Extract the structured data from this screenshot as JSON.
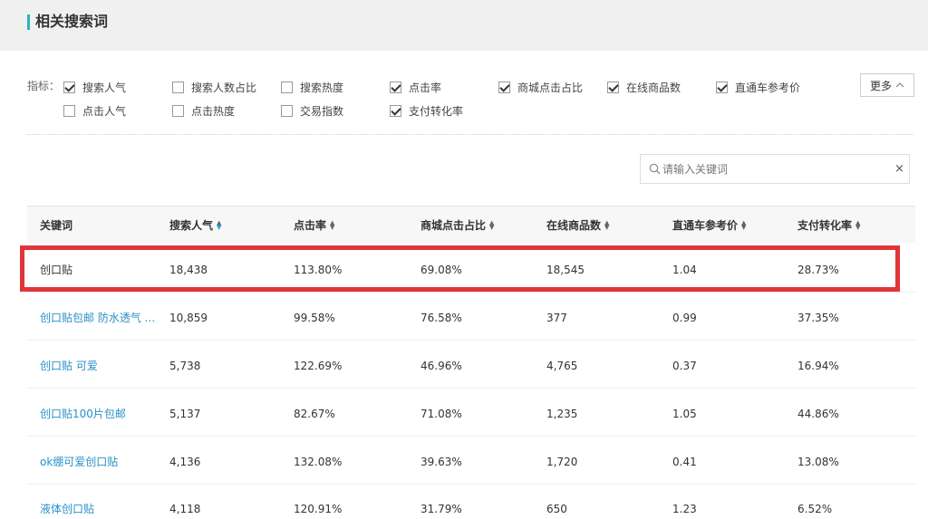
{
  "header": {
    "title": "相关搜索词"
  },
  "filters": {
    "label": "指标：",
    "items": [
      {
        "label": "搜索人气",
        "checked": true
      },
      {
        "label": "搜索人数占比",
        "checked": false
      },
      {
        "label": "搜索热度",
        "checked": false
      },
      {
        "label": "点击率",
        "checked": true
      },
      {
        "label": "商城点击占比",
        "checked": true
      },
      {
        "label": "在线商品数",
        "checked": true
      },
      {
        "label": "直通车参考价",
        "checked": true
      },
      {
        "label": "点击人气",
        "checked": false
      },
      {
        "label": "点击热度",
        "checked": false
      },
      {
        "label": "交易指数",
        "checked": false
      },
      {
        "label": "支付转化率",
        "checked": true
      }
    ],
    "more_label": "更多"
  },
  "search": {
    "placeholder": "请输入关键词",
    "value": "",
    "clear_label": "×"
  },
  "table": {
    "columns": [
      "关键词",
      "搜索人气",
      "点击率",
      "商城点击占比",
      "在线商品数",
      "直通车参考价",
      "支付转化率"
    ],
    "active_sort_column": "搜索人气",
    "rows": [
      {
        "keyword": "创口贴",
        "search_popularity": "18,438",
        "click_rate": "113.80%",
        "mall_click_share": "69.08%",
        "online_items": "18,545",
        "ztc_price": "1.04",
        "pay_conversion": "28.73%"
      },
      {
        "keyword": "创口贴包邮 防水透气 ...",
        "search_popularity": "10,859",
        "click_rate": "99.58%",
        "mall_click_share": "76.58%",
        "online_items": "377",
        "ztc_price": "0.99",
        "pay_conversion": "37.35%"
      },
      {
        "keyword": "创口贴 可爱",
        "search_popularity": "5,738",
        "click_rate": "122.69%",
        "mall_click_share": "46.96%",
        "online_items": "4,765",
        "ztc_price": "0.37",
        "pay_conversion": "16.94%"
      },
      {
        "keyword": "创口贴100片包邮",
        "search_popularity": "5,137",
        "click_rate": "82.67%",
        "mall_click_share": "71.08%",
        "online_items": "1,235",
        "ztc_price": "1.05",
        "pay_conversion": "44.86%"
      },
      {
        "keyword": "ok绷可爱创口贴",
        "search_popularity": "4,136",
        "click_rate": "132.08%",
        "mall_click_share": "39.63%",
        "online_items": "1,720",
        "ztc_price": "0.41",
        "pay_conversion": "13.08%"
      },
      {
        "keyword": "液体创口贴",
        "search_popularity": "4,118",
        "click_rate": "120.91%",
        "mall_click_share": "31.79%",
        "online_items": "650",
        "ztc_price": "1.23",
        "pay_conversion": "6.52%"
      }
    ]
  },
  "colors": {
    "accent": "#2bb3c0",
    "link": "#2a8fc9",
    "highlight_border": "#e0353a"
  }
}
